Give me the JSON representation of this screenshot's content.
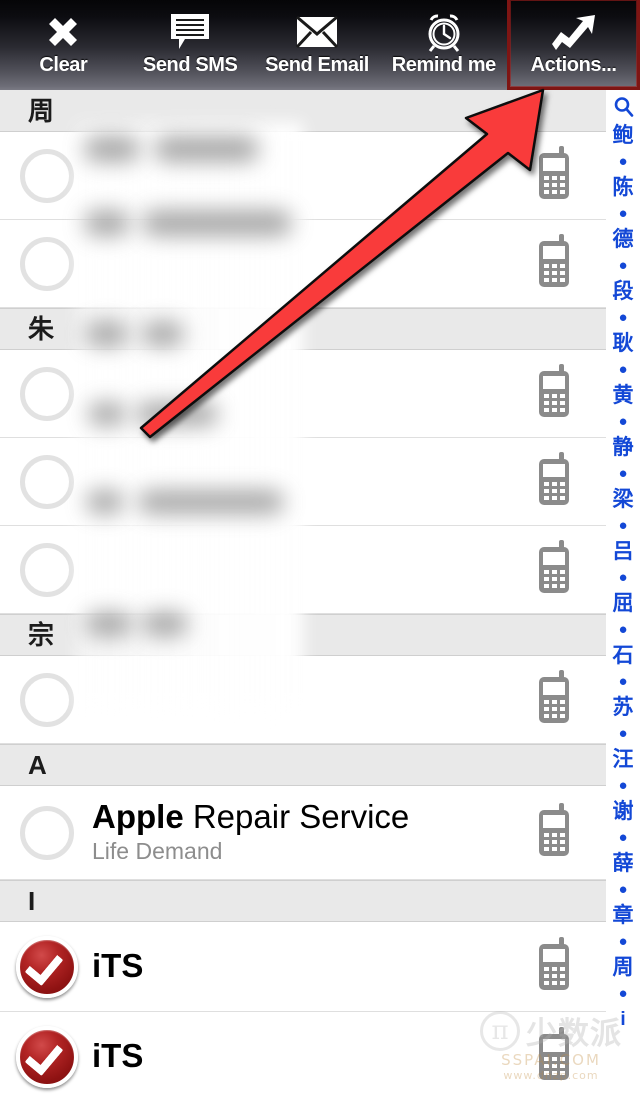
{
  "toolbar": {
    "buttons": [
      {
        "label": "Clear",
        "icon": "close-x-icon",
        "highlighted": false
      },
      {
        "label": "Send SMS",
        "icon": "message-icon",
        "highlighted": false
      },
      {
        "label": "Send Email",
        "icon": "envelope-icon",
        "highlighted": false
      },
      {
        "label": "Remind me",
        "icon": "alarm-clock-icon",
        "highlighted": false
      },
      {
        "label": "Actions...",
        "icon": "trend-up-icon",
        "highlighted": true
      }
    ],
    "highlight_color": "#7e1513"
  },
  "list": {
    "sections": [
      {
        "header": "周",
        "rows": [
          {
            "title": "",
            "subtitle": "",
            "checked": false,
            "blurred": true,
            "phone_icon": "mobile-phone-icon"
          },
          {
            "title": "",
            "subtitle": "",
            "checked": false,
            "blurred": true,
            "phone_icon": "mobile-phone-icon"
          }
        ]
      },
      {
        "header": "朱",
        "rows": [
          {
            "title": "",
            "subtitle": "",
            "checked": false,
            "blurred": true,
            "phone_icon": "mobile-phone-icon"
          },
          {
            "title": "",
            "subtitle": "",
            "checked": false,
            "blurred": true,
            "phone_icon": "mobile-phone-icon"
          },
          {
            "title": "",
            "subtitle": "",
            "checked": false,
            "blurred": true,
            "phone_icon": "mobile-phone-icon"
          }
        ]
      },
      {
        "header": "宗",
        "rows": [
          {
            "title": "",
            "subtitle": "",
            "checked": false,
            "blurred": true,
            "phone_icon": "mobile-phone-icon"
          }
        ]
      },
      {
        "header": "A",
        "rows": [
          {
            "title_bold": "Apple",
            "title_rest": " Repair Service",
            "subtitle": "Life Demand",
            "checked": false,
            "blurred": false,
            "phone_icon": "mobile-phone-icon"
          }
        ]
      },
      {
        "header": "I",
        "rows": [
          {
            "title_bold": "iTS",
            "title_rest": "",
            "subtitle": "",
            "checked": true,
            "blurred": false,
            "phone_icon": "mobile-phone-icon"
          },
          {
            "title_bold": "iTS",
            "title_rest": "",
            "subtitle": "",
            "checked": true,
            "blurred": false,
            "phone_icon": "mobile-phone-icon"
          }
        ]
      }
    ]
  },
  "index_bar": {
    "color": "#1348d6",
    "entries": [
      {
        "label": "ὐD",
        "type": "search-icon"
      },
      {
        "label": "鲍",
        "type": "letter"
      },
      {
        "label": "●",
        "type": "dot"
      },
      {
        "label": "陈",
        "type": "letter"
      },
      {
        "label": "●",
        "type": "dot"
      },
      {
        "label": "德",
        "type": "letter"
      },
      {
        "label": "●",
        "type": "dot"
      },
      {
        "label": "段",
        "type": "letter"
      },
      {
        "label": "●",
        "type": "dot"
      },
      {
        "label": "耿",
        "type": "letter"
      },
      {
        "label": "●",
        "type": "dot"
      },
      {
        "label": "黄",
        "type": "letter"
      },
      {
        "label": "●",
        "type": "dot"
      },
      {
        "label": "静",
        "type": "letter"
      },
      {
        "label": "●",
        "type": "dot"
      },
      {
        "label": "梁",
        "type": "letter"
      },
      {
        "label": "●",
        "type": "dot"
      },
      {
        "label": "吕",
        "type": "letter"
      },
      {
        "label": "●",
        "type": "dot"
      },
      {
        "label": "屈",
        "type": "letter"
      },
      {
        "label": "●",
        "type": "dot"
      },
      {
        "label": "石",
        "type": "letter"
      },
      {
        "label": "●",
        "type": "dot"
      },
      {
        "label": "苏",
        "type": "letter"
      },
      {
        "label": "●",
        "type": "dot"
      },
      {
        "label": "汪",
        "type": "letter"
      },
      {
        "label": "●",
        "type": "dot"
      },
      {
        "label": "谢",
        "type": "letter"
      },
      {
        "label": "●",
        "type": "dot"
      },
      {
        "label": "薛",
        "type": "letter"
      },
      {
        "label": "●",
        "type": "dot"
      },
      {
        "label": "章",
        "type": "letter"
      },
      {
        "label": "●",
        "type": "dot"
      },
      {
        "label": "周",
        "type": "letter"
      },
      {
        "label": "●",
        "type": "dot"
      },
      {
        "label": "i",
        "type": "letter"
      }
    ]
  },
  "annotation": {
    "arrow_color": "#f93a3a",
    "arrow_from": "140,425",
    "arrow_to": "540,92"
  },
  "watermark": {
    "pi": "π",
    "cn": "少数派",
    "site": "SSPAI.COM",
    "url": "www.dnzp.com"
  }
}
